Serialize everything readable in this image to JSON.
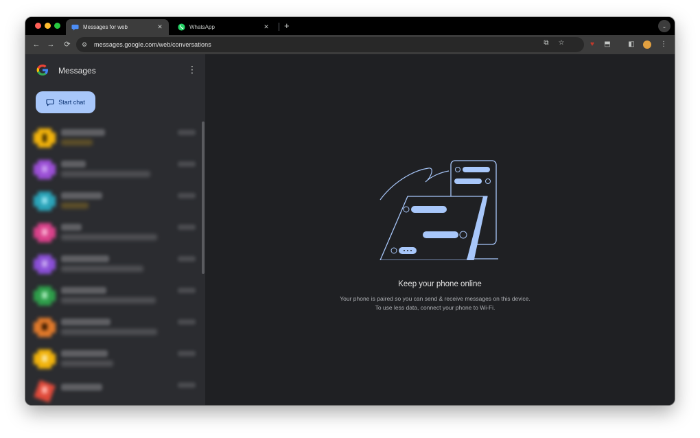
{
  "browser": {
    "tabs": [
      {
        "title": "Messages for web",
        "icon": "google-messages-icon",
        "active": true
      },
      {
        "title": "WhatsApp",
        "icon": "whatsapp-icon",
        "active": false
      }
    ],
    "url": "messages.google.com/web/conversations"
  },
  "app": {
    "title": "Messages",
    "start_chat_label": "Start chat",
    "empty_state": {
      "title": "Keep your phone online",
      "description": "Your phone is paired so you can send & receive messages on this device. To use less data, connect your phone to Wi-Fi."
    }
  },
  "colors": {
    "accent": "#a8c7fa",
    "sidebar_bg": "#2b2c30",
    "main_bg": "#1f2023",
    "avatars": [
      "#f2b30b",
      "#9b4fd6",
      "#2aa3b8",
      "#d9418a",
      "#8a4fd6",
      "#2e9e4a",
      "#e0792a",
      "#f2b30b",
      "#e04a3a"
    ]
  }
}
